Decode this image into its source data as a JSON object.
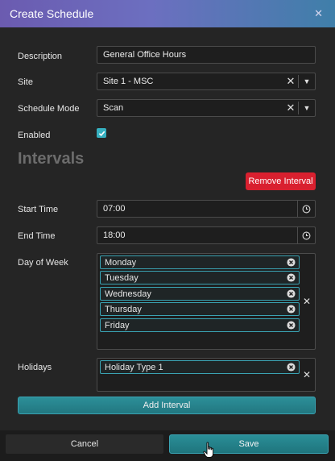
{
  "dialog": {
    "title": "Create Schedule",
    "close_icon": "close-icon"
  },
  "form": {
    "description": {
      "label": "Description",
      "value": "General Office Hours"
    },
    "site": {
      "label": "Site",
      "value": "Site 1 - MSC"
    },
    "schedule_mode": {
      "label": "Schedule Mode",
      "value": "Scan"
    },
    "enabled": {
      "label": "Enabled",
      "checked": true
    }
  },
  "intervals": {
    "title": "Intervals",
    "remove_label": "Remove Interval",
    "start_time": {
      "label": "Start Time",
      "value": "07:00"
    },
    "end_time": {
      "label": "End Time",
      "value": "18:00"
    },
    "day_of_week": {
      "label": "Day of Week",
      "selected": [
        "Monday",
        "Tuesday",
        "Wednesday",
        "Thursday",
        "Friday"
      ]
    },
    "holidays": {
      "label": "Holidays",
      "selected": [
        "Holiday Type 1"
      ]
    },
    "add_label": "Add Interval"
  },
  "footer": {
    "cancel_label": "Cancel",
    "save_label": "Save"
  },
  "colors": {
    "accent": "#36b0c0",
    "danger": "#d9202f",
    "header_start": "#6b5bb0",
    "header_end": "#3f7fa9"
  }
}
